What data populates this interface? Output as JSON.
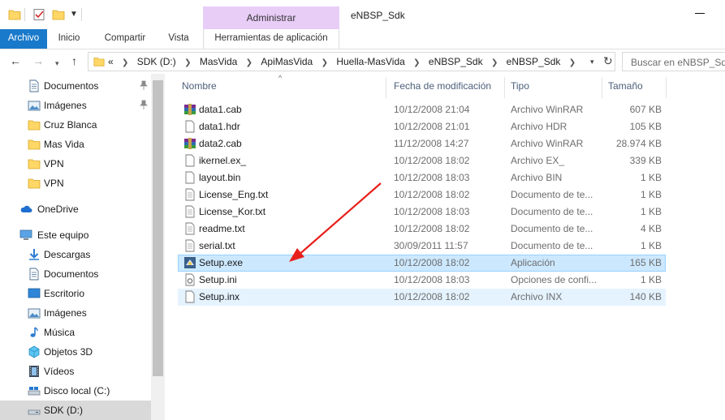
{
  "window": {
    "title": "eNBSP_Sdk",
    "manage_label": "Administrar"
  },
  "ribbon": {
    "tabs": [
      "Archivo",
      "Inicio",
      "Compartir",
      "Vista",
      "Herramientas de aplicación"
    ]
  },
  "address": {
    "prefix": "«",
    "crumbs": [
      "SDK (D:)",
      "MasVida",
      "ApiMasVida",
      "Huella-MasVida",
      "eNBSP_Sdk",
      "eNBSP_Sdk"
    ],
    "search_placeholder": "Buscar en eNBSP_Sdk"
  },
  "sidebar": {
    "quick_access": [
      {
        "label": "Documentos",
        "icon": "documents-icon",
        "pinned": true
      },
      {
        "label": "Imágenes",
        "icon": "pictures-icon",
        "pinned": true
      },
      {
        "label": "Cruz Blanca",
        "icon": "folder-icon",
        "pinned": false
      },
      {
        "label": "Mas Vida",
        "icon": "folder-icon",
        "pinned": false
      },
      {
        "label": "VPN",
        "icon": "folder-icon",
        "pinned": false
      },
      {
        "label": "VPN",
        "icon": "folder-icon",
        "pinned": false
      }
    ],
    "onedrive": {
      "label": "OneDrive",
      "icon": "cloud-icon"
    },
    "this_pc": {
      "label": "Este equipo",
      "icon": "computer-icon"
    },
    "pc_items": [
      {
        "label": "Descargas",
        "icon": "downloads-icon"
      },
      {
        "label": "Documentos",
        "icon": "documents-icon"
      },
      {
        "label": "Escritorio",
        "icon": "desktop-icon"
      },
      {
        "label": "Imágenes",
        "icon": "pictures-icon"
      },
      {
        "label": "Música",
        "icon": "music-icon"
      },
      {
        "label": "Objetos 3D",
        "icon": "objects3d-icon"
      },
      {
        "label": "Vídeos",
        "icon": "videos-icon"
      },
      {
        "label": "Disco local (C:)",
        "icon": "drive-icon"
      },
      {
        "label": "SDK (D:)",
        "icon": "drive-icon"
      }
    ]
  },
  "columns": {
    "name": "Nombre",
    "date": "Fecha de modificación",
    "type": "Tipo",
    "size": "Tamaño"
  },
  "files": [
    {
      "name": "data1.cab",
      "date": "10/12/2008 21:04",
      "type": "Archivo WinRAR",
      "size": "607 KB",
      "icon": "winrar-icon"
    },
    {
      "name": "data1.hdr",
      "date": "10/12/2008 21:01",
      "type": "Archivo HDR",
      "size": "105 KB",
      "icon": "file-icon"
    },
    {
      "name": "data2.cab",
      "date": "11/12/2008 14:27",
      "type": "Archivo WinRAR",
      "size": "28.974 KB",
      "icon": "winrar-icon"
    },
    {
      "name": "ikernel.ex_",
      "date": "10/12/2008 18:02",
      "type": "Archivo EX_",
      "size": "339 KB",
      "icon": "file-icon"
    },
    {
      "name": "layout.bin",
      "date": "10/12/2008 18:03",
      "type": "Archivo BIN",
      "size": "1 KB",
      "icon": "file-icon"
    },
    {
      "name": "License_Eng.txt",
      "date": "10/12/2008 18:02",
      "type": "Documento de te...",
      "size": "1 KB",
      "icon": "text-file-icon"
    },
    {
      "name": "License_Kor.txt",
      "date": "10/12/2008 18:03",
      "type": "Documento de te...",
      "size": "1 KB",
      "icon": "text-file-icon"
    },
    {
      "name": "readme.txt",
      "date": "10/12/2008 18:02",
      "type": "Documento de te...",
      "size": "4 KB",
      "icon": "text-file-icon"
    },
    {
      "name": "serial.txt",
      "date": "30/09/2011 11:57",
      "type": "Documento de te...",
      "size": "1 KB",
      "icon": "text-file-icon"
    },
    {
      "name": "Setup.exe",
      "date": "10/12/2008 18:02",
      "type": "Aplicación",
      "size": "165 KB",
      "icon": "setup-app-icon"
    },
    {
      "name": "Setup.ini",
      "date": "10/12/2008 18:03",
      "type": "Opciones de confi...",
      "size": "1 KB",
      "icon": "settings-file-icon"
    },
    {
      "name": "Setup.inx",
      "date": "10/12/2008 18:02",
      "type": "Archivo INX",
      "size": "140 KB",
      "icon": "file-icon"
    }
  ],
  "colors": {
    "accent": "#1979ca",
    "manage": "#e8cdf7",
    "selection": "#cce8ff",
    "hover": "#e5f3ff",
    "annotation_arrow": "#e8201c",
    "header_text": "#4c607a"
  }
}
